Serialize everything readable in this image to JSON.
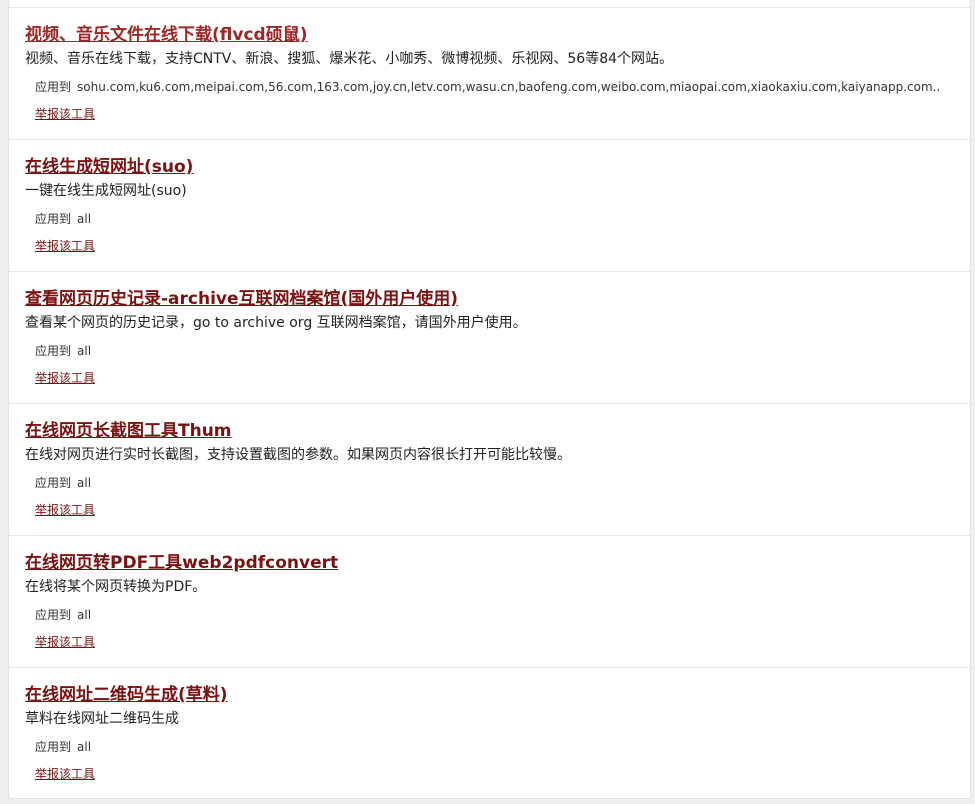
{
  "tools": [
    {
      "title": "视频、音乐文件在线下载(flvcd硕鼠)",
      "description": "视频、音乐在线下载，支持CNTV、新浪、搜狐、爆米花、小咖秀、微博视频、乐视网、56等84个网站。",
      "applies_label": "应用到",
      "applies_value": "sohu.com,ku6.com,meipai.com,56.com,163.com,joy.cn,letv.com,wasu.cn,baofeng.com,weibo.com,miaopai.com,xiaokaxiu.com,kaiyanapp.com..",
      "report_label": "举报该工具"
    },
    {
      "title": "在线生成短网址(suo)",
      "description": "一键在线生成短网址(suo)",
      "applies_label": "应用到",
      "applies_value": "all",
      "report_label": "举报该工具"
    },
    {
      "title": "查看网页历史记录-archive互联网档案馆(国外用户使用)",
      "description": "查看某个网页的历史记录，go to archive org 互联网档案馆，请国外用户使用。",
      "applies_label": "应用到",
      "applies_value": "all",
      "report_label": "举报该工具"
    },
    {
      "title": "在线网页长截图工具Thum",
      "description": "在线对网页进行实时长截图，支持设置截图的参数。如果网页内容很长打开可能比较慢。",
      "applies_label": "应用到",
      "applies_value": "all",
      "report_label": "举报该工具"
    },
    {
      "title": "在线网页转PDF工具web2pdfconvert",
      "description": "在线将某个网页转换为PDF。",
      "applies_label": "应用到",
      "applies_value": "all",
      "report_label": "举报该工具"
    },
    {
      "title": "在线网址二维码生成(草料)",
      "description": "草料在线网址二维码生成",
      "applies_label": "应用到",
      "applies_value": "all",
      "report_label": "举报该工具"
    }
  ],
  "colors": {
    "link": "#7a1212",
    "link_visited": "#9c2727",
    "text": "#222222",
    "background": "#efefef"
  }
}
